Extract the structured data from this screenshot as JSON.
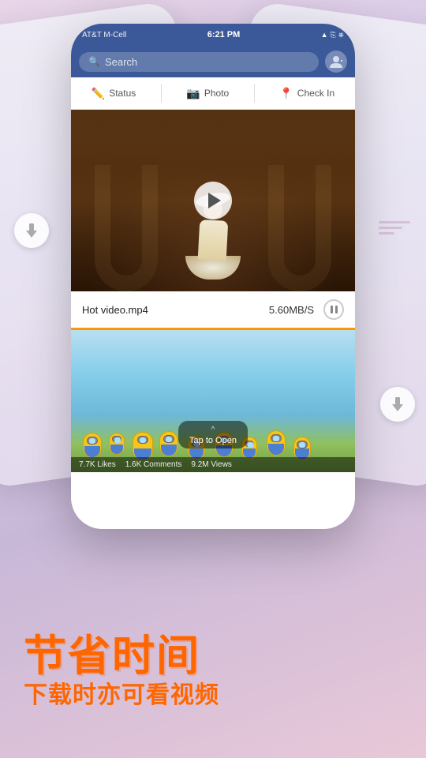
{
  "background": {
    "gradient_start": "#e8d5e8",
    "gradient_end": "#e8c8d8"
  },
  "phone": {
    "status_bar": {
      "carrier": "AT&T M-Cell",
      "time": "6:21 PM",
      "signal_icons": "↑ ⓑ"
    },
    "search_bar": {
      "placeholder": "Search",
      "has_avatar": true
    },
    "action_bar": {
      "items": [
        {
          "icon": "✏️",
          "label": "Status"
        },
        {
          "icon": "📷",
          "label": "Photo"
        },
        {
          "icon": "📍",
          "label": "Check In"
        }
      ]
    },
    "video1": {
      "play_button": true,
      "description": "Dancing woman in archway"
    },
    "download_bar": {
      "filename": "Hot video.mp4",
      "speed": "5.60MB/S",
      "paused": true
    },
    "video2": {
      "description": "Minions animation",
      "tap_label": "Tap to Open",
      "stats": {
        "likes": "7.7K Likes",
        "comments": "1.6K Comments",
        "views": "9.2M Views"
      }
    }
  },
  "bottom_text": {
    "title": "节省时间",
    "subtitle": "下载时亦可看视频"
  },
  "side_arrows": {
    "left_visible": true,
    "right_visible": true
  },
  "deco_lines": {
    "widths": [
      40,
      30,
      20
    ]
  }
}
